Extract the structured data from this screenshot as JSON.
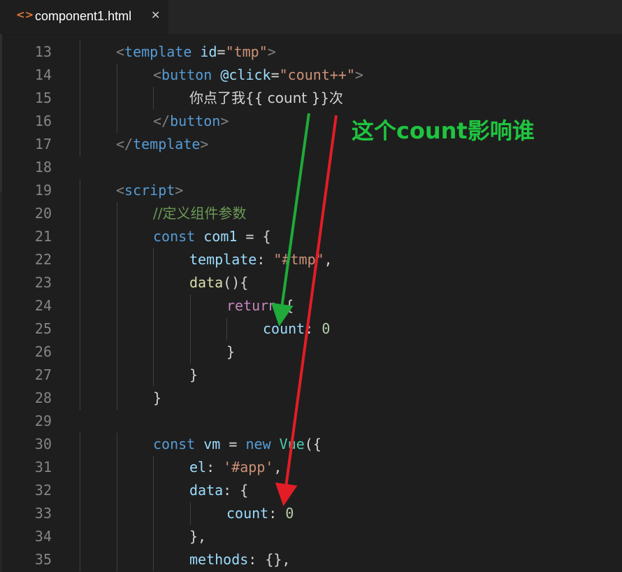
{
  "tab": {
    "icon": "code-brackets-icon",
    "icon_glyph": "<>",
    "title": "component1.html",
    "close_glyph": "✕"
  },
  "lines": [
    {
      "n": "13",
      "indent": 1,
      "tokens": [
        [
          "punc",
          "<"
        ],
        [
          "tagname",
          "template"
        ],
        [
          "txt",
          " "
        ],
        [
          "attr",
          "id"
        ],
        [
          "op",
          "="
        ],
        [
          "str",
          "\"tmp\""
        ],
        [
          "punc",
          ">"
        ]
      ]
    },
    {
      "n": "14",
      "indent": 2,
      "tokens": [
        [
          "punc",
          "<"
        ],
        [
          "tagname",
          "button"
        ],
        [
          "txt",
          " "
        ],
        [
          "attr",
          "@click"
        ],
        [
          "op",
          "="
        ],
        [
          "str",
          "\"count++\""
        ],
        [
          "punc",
          ">"
        ]
      ]
    },
    {
      "n": "15",
      "indent": 3,
      "tokens": [
        [
          "txt",
          "你点了我{{ count }}次"
        ]
      ]
    },
    {
      "n": "16",
      "indent": 2,
      "tokens": [
        [
          "punc",
          "</"
        ],
        [
          "tagname",
          "button"
        ],
        [
          "punc",
          ">"
        ]
      ]
    },
    {
      "n": "17",
      "indent": 1,
      "tokens": [
        [
          "punc",
          "</"
        ],
        [
          "tagname",
          "template"
        ],
        [
          "punc",
          ">"
        ]
      ]
    },
    {
      "n": "18",
      "indent": 0,
      "tokens": []
    },
    {
      "n": "19",
      "indent": 1,
      "tokens": [
        [
          "punc",
          "<"
        ],
        [
          "tagname",
          "script"
        ],
        [
          "punc",
          ">"
        ]
      ]
    },
    {
      "n": "20",
      "indent": 2,
      "tokens": [
        [
          "cmt",
          "//定义组件参数"
        ]
      ]
    },
    {
      "n": "21",
      "indent": 2,
      "tokens": [
        [
          "kw",
          "const"
        ],
        [
          "txt",
          " "
        ],
        [
          "var",
          "com1"
        ],
        [
          "op",
          " = {"
        ]
      ]
    },
    {
      "n": "22",
      "indent": 3,
      "tokens": [
        [
          "var",
          "template"
        ],
        [
          "op",
          ": "
        ],
        [
          "str",
          "\"#tmp\""
        ],
        [
          "op",
          ","
        ]
      ]
    },
    {
      "n": "23",
      "indent": 3,
      "tokens": [
        [
          "fn",
          "data"
        ],
        [
          "op",
          "(){"
        ]
      ]
    },
    {
      "n": "24",
      "indent": 4,
      "tokens": [
        [
          "ctrl",
          "return"
        ],
        [
          "op",
          " {"
        ]
      ]
    },
    {
      "n": "25",
      "indent": 5,
      "tokens": [
        [
          "var",
          "count"
        ],
        [
          "op",
          ": "
        ],
        [
          "num",
          "0"
        ]
      ]
    },
    {
      "n": "26",
      "indent": 4,
      "tokens": [
        [
          "op",
          "}"
        ]
      ]
    },
    {
      "n": "27",
      "indent": 3,
      "tokens": [
        [
          "op",
          "}"
        ]
      ]
    },
    {
      "n": "28",
      "indent": 2,
      "tokens": [
        [
          "op",
          "}"
        ]
      ]
    },
    {
      "n": "29",
      "indent": 0,
      "tokens": []
    },
    {
      "n": "30",
      "indent": 2,
      "tokens": [
        [
          "kw",
          "const"
        ],
        [
          "txt",
          " "
        ],
        [
          "var",
          "vm"
        ],
        [
          "op",
          " = "
        ],
        [
          "kw",
          "new"
        ],
        [
          "txt",
          " "
        ],
        [
          "cls",
          "Vue"
        ],
        [
          "op",
          "({"
        ]
      ]
    },
    {
      "n": "31",
      "indent": 3,
      "tokens": [
        [
          "var",
          "el"
        ],
        [
          "op",
          ": "
        ],
        [
          "str",
          "'#app'"
        ],
        [
          "op",
          ","
        ]
      ]
    },
    {
      "n": "32",
      "indent": 3,
      "tokens": [
        [
          "var",
          "data"
        ],
        [
          "op",
          ": {"
        ]
      ]
    },
    {
      "n": "33",
      "indent": 4,
      "tokens": [
        [
          "var",
          "count"
        ],
        [
          "op",
          ": "
        ],
        [
          "num",
          "0"
        ]
      ]
    },
    {
      "n": "34",
      "indent": 3,
      "tokens": [
        [
          "op",
          "},"
        ]
      ]
    },
    {
      "n": "35",
      "indent": 3,
      "tokens": [
        [
          "var",
          "methods"
        ],
        [
          "op",
          ": {},"
        ]
      ]
    }
  ],
  "annotation": {
    "text": "这个count影响谁",
    "color": "#1fc43f"
  },
  "arrows": {
    "green": "#1faa3a",
    "red": "#e21d26"
  }
}
